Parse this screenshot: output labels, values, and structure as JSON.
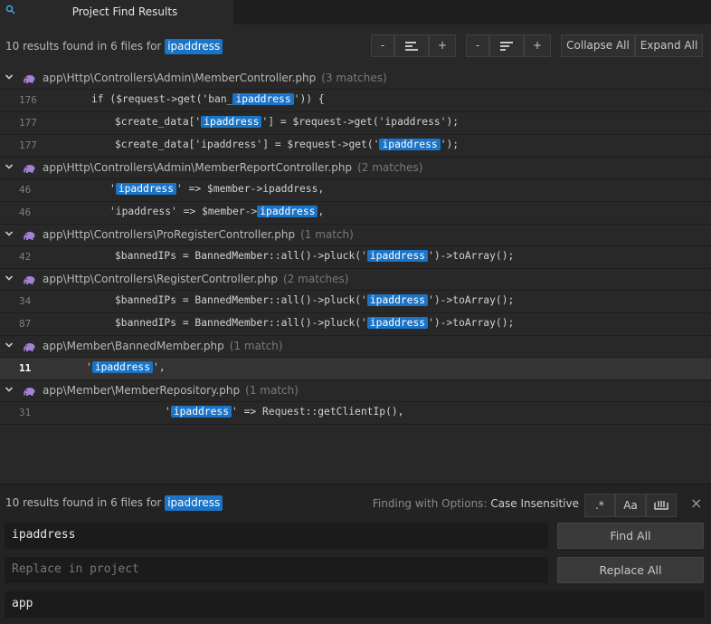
{
  "tab": {
    "title": "Project Find Results",
    "icon": "search-icon"
  },
  "header": {
    "summary_prefix": "10 results found in 6 files for",
    "query": "ipaddress",
    "buttons": {
      "minus1": "-",
      "plus1": "+",
      "minus2": "-",
      "plus2": "+",
      "collapse_all": "Collapse All",
      "expand_all": "Expand All"
    }
  },
  "files": [
    {
      "path": "app\\Http\\Controllers\\Admin\\MemberController.php",
      "count": "(3 matches)",
      "matches": [
        {
          "line": "176",
          "indent": 101,
          "pre": "if ($request->get('ban_",
          "hl": "ipaddress",
          "post": "')) {"
        },
        {
          "line": "177",
          "indent": 127,
          "pre": "$create_data['",
          "hl": "ipaddress",
          "post": "'] = $request->get('ipaddress');"
        },
        {
          "line": "177",
          "indent": 127,
          "pre": "$create_data['ipaddress'] = $request->get('",
          "hl": "ipaddress",
          "post": "');"
        }
      ]
    },
    {
      "path": "app\\Http\\Controllers\\Admin\\MemberReportController.php",
      "count": "(2 matches)",
      "matches": [
        {
          "line": "46",
          "indent": 121,
          "pre": "'",
          "hl": "ipaddress",
          "post": "' => $member->ipaddress,"
        },
        {
          "line": "46",
          "indent": 121,
          "pre": "'ipaddress' => $member->",
          "hl": "ipaddress",
          "post": ","
        }
      ]
    },
    {
      "path": "app\\Http\\Controllers\\ProRegisterController.php",
      "count": "(1 match)",
      "matches": [
        {
          "line": "42",
          "indent": 127,
          "pre": "$bannedIPs = BannedMember::all()->pluck('",
          "hl": "ipaddress",
          "post": "')->toArray();"
        }
      ]
    },
    {
      "path": "app\\Http\\Controllers\\RegisterController.php",
      "count": "(2 matches)",
      "matches": [
        {
          "line": "34",
          "indent": 127,
          "pre": "$bannedIPs = BannedMember::all()->pluck('",
          "hl": "ipaddress",
          "post": "')->toArray();"
        },
        {
          "line": "87",
          "indent": 127,
          "pre": "$bannedIPs = BannedMember::all()->pluck('",
          "hl": "ipaddress",
          "post": "')->toArray();"
        }
      ]
    },
    {
      "path": "app\\Member\\BannedMember.php",
      "count": "(1 match)",
      "matches": [
        {
          "line": "11",
          "indent": 95,
          "pre": "'",
          "hl": "ipaddress",
          "post": "',",
          "selected": true
        }
      ]
    },
    {
      "path": "app\\Member\\MemberRepository.php",
      "count": "(1 match)",
      "matches": [
        {
          "line": "31",
          "indent": 182,
          "pre": "'",
          "hl": "ipaddress",
          "post": "' => Request::getClientIp(),"
        }
      ]
    }
  ],
  "find_panel": {
    "summary_prefix": "10 results found in 6 files for",
    "query": "ipaddress",
    "options_label": "Finding with Options:",
    "options_value": "Case Insensitive",
    "opt_regex": ".*",
    "opt_case": "Aa",
    "opt_word": "word-boundary-icon",
    "close": "×",
    "find_value": "ipaddress",
    "replace_placeholder": "Replace in project",
    "paths_value": "app",
    "find_all": "Find All",
    "replace_all": "Replace All"
  },
  "colors": {
    "accent": "#1c74c7",
    "background": "#282828",
    "php_icon": "#a67fd6"
  }
}
